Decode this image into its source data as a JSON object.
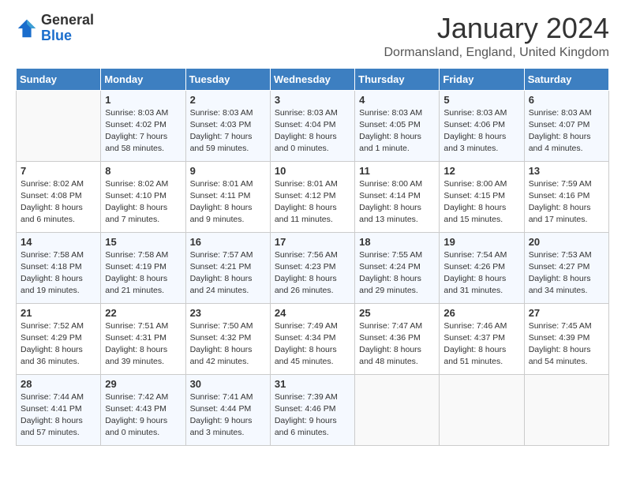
{
  "header": {
    "logo_general": "General",
    "logo_blue": "Blue",
    "title": "January 2024",
    "location": "Dormansland, England, United Kingdom"
  },
  "days_of_week": [
    "Sunday",
    "Monday",
    "Tuesday",
    "Wednesday",
    "Thursday",
    "Friday",
    "Saturday"
  ],
  "weeks": [
    [
      {
        "day": "",
        "info": ""
      },
      {
        "day": "1",
        "info": "Sunrise: 8:03 AM\nSunset: 4:02 PM\nDaylight: 7 hours\nand 58 minutes."
      },
      {
        "day": "2",
        "info": "Sunrise: 8:03 AM\nSunset: 4:03 PM\nDaylight: 7 hours\nand 59 minutes."
      },
      {
        "day": "3",
        "info": "Sunrise: 8:03 AM\nSunset: 4:04 PM\nDaylight: 8 hours\nand 0 minutes."
      },
      {
        "day": "4",
        "info": "Sunrise: 8:03 AM\nSunset: 4:05 PM\nDaylight: 8 hours\nand 1 minute."
      },
      {
        "day": "5",
        "info": "Sunrise: 8:03 AM\nSunset: 4:06 PM\nDaylight: 8 hours\nand 3 minutes."
      },
      {
        "day": "6",
        "info": "Sunrise: 8:03 AM\nSunset: 4:07 PM\nDaylight: 8 hours\nand 4 minutes."
      }
    ],
    [
      {
        "day": "7",
        "info": "Sunrise: 8:02 AM\nSunset: 4:08 PM\nDaylight: 8 hours\nand 6 minutes."
      },
      {
        "day": "8",
        "info": "Sunrise: 8:02 AM\nSunset: 4:10 PM\nDaylight: 8 hours\nand 7 minutes."
      },
      {
        "day": "9",
        "info": "Sunrise: 8:01 AM\nSunset: 4:11 PM\nDaylight: 8 hours\nand 9 minutes."
      },
      {
        "day": "10",
        "info": "Sunrise: 8:01 AM\nSunset: 4:12 PM\nDaylight: 8 hours\nand 11 minutes."
      },
      {
        "day": "11",
        "info": "Sunrise: 8:00 AM\nSunset: 4:14 PM\nDaylight: 8 hours\nand 13 minutes."
      },
      {
        "day": "12",
        "info": "Sunrise: 8:00 AM\nSunset: 4:15 PM\nDaylight: 8 hours\nand 15 minutes."
      },
      {
        "day": "13",
        "info": "Sunrise: 7:59 AM\nSunset: 4:16 PM\nDaylight: 8 hours\nand 17 minutes."
      }
    ],
    [
      {
        "day": "14",
        "info": "Sunrise: 7:58 AM\nSunset: 4:18 PM\nDaylight: 8 hours\nand 19 minutes."
      },
      {
        "day": "15",
        "info": "Sunrise: 7:58 AM\nSunset: 4:19 PM\nDaylight: 8 hours\nand 21 minutes."
      },
      {
        "day": "16",
        "info": "Sunrise: 7:57 AM\nSunset: 4:21 PM\nDaylight: 8 hours\nand 24 minutes."
      },
      {
        "day": "17",
        "info": "Sunrise: 7:56 AM\nSunset: 4:23 PM\nDaylight: 8 hours\nand 26 minutes."
      },
      {
        "day": "18",
        "info": "Sunrise: 7:55 AM\nSunset: 4:24 PM\nDaylight: 8 hours\nand 29 minutes."
      },
      {
        "day": "19",
        "info": "Sunrise: 7:54 AM\nSunset: 4:26 PM\nDaylight: 8 hours\nand 31 minutes."
      },
      {
        "day": "20",
        "info": "Sunrise: 7:53 AM\nSunset: 4:27 PM\nDaylight: 8 hours\nand 34 minutes."
      }
    ],
    [
      {
        "day": "21",
        "info": "Sunrise: 7:52 AM\nSunset: 4:29 PM\nDaylight: 8 hours\nand 36 minutes."
      },
      {
        "day": "22",
        "info": "Sunrise: 7:51 AM\nSunset: 4:31 PM\nDaylight: 8 hours\nand 39 minutes."
      },
      {
        "day": "23",
        "info": "Sunrise: 7:50 AM\nSunset: 4:32 PM\nDaylight: 8 hours\nand 42 minutes."
      },
      {
        "day": "24",
        "info": "Sunrise: 7:49 AM\nSunset: 4:34 PM\nDaylight: 8 hours\nand 45 minutes."
      },
      {
        "day": "25",
        "info": "Sunrise: 7:47 AM\nSunset: 4:36 PM\nDaylight: 8 hours\nand 48 minutes."
      },
      {
        "day": "26",
        "info": "Sunrise: 7:46 AM\nSunset: 4:37 PM\nDaylight: 8 hours\nand 51 minutes."
      },
      {
        "day": "27",
        "info": "Sunrise: 7:45 AM\nSunset: 4:39 PM\nDaylight: 8 hours\nand 54 minutes."
      }
    ],
    [
      {
        "day": "28",
        "info": "Sunrise: 7:44 AM\nSunset: 4:41 PM\nDaylight: 8 hours\nand 57 minutes."
      },
      {
        "day": "29",
        "info": "Sunrise: 7:42 AM\nSunset: 4:43 PM\nDaylight: 9 hours\nand 0 minutes."
      },
      {
        "day": "30",
        "info": "Sunrise: 7:41 AM\nSunset: 4:44 PM\nDaylight: 9 hours\nand 3 minutes."
      },
      {
        "day": "31",
        "info": "Sunrise: 7:39 AM\nSunset: 4:46 PM\nDaylight: 9 hours\nand 6 minutes."
      },
      {
        "day": "",
        "info": ""
      },
      {
        "day": "",
        "info": ""
      },
      {
        "day": "",
        "info": ""
      }
    ]
  ]
}
